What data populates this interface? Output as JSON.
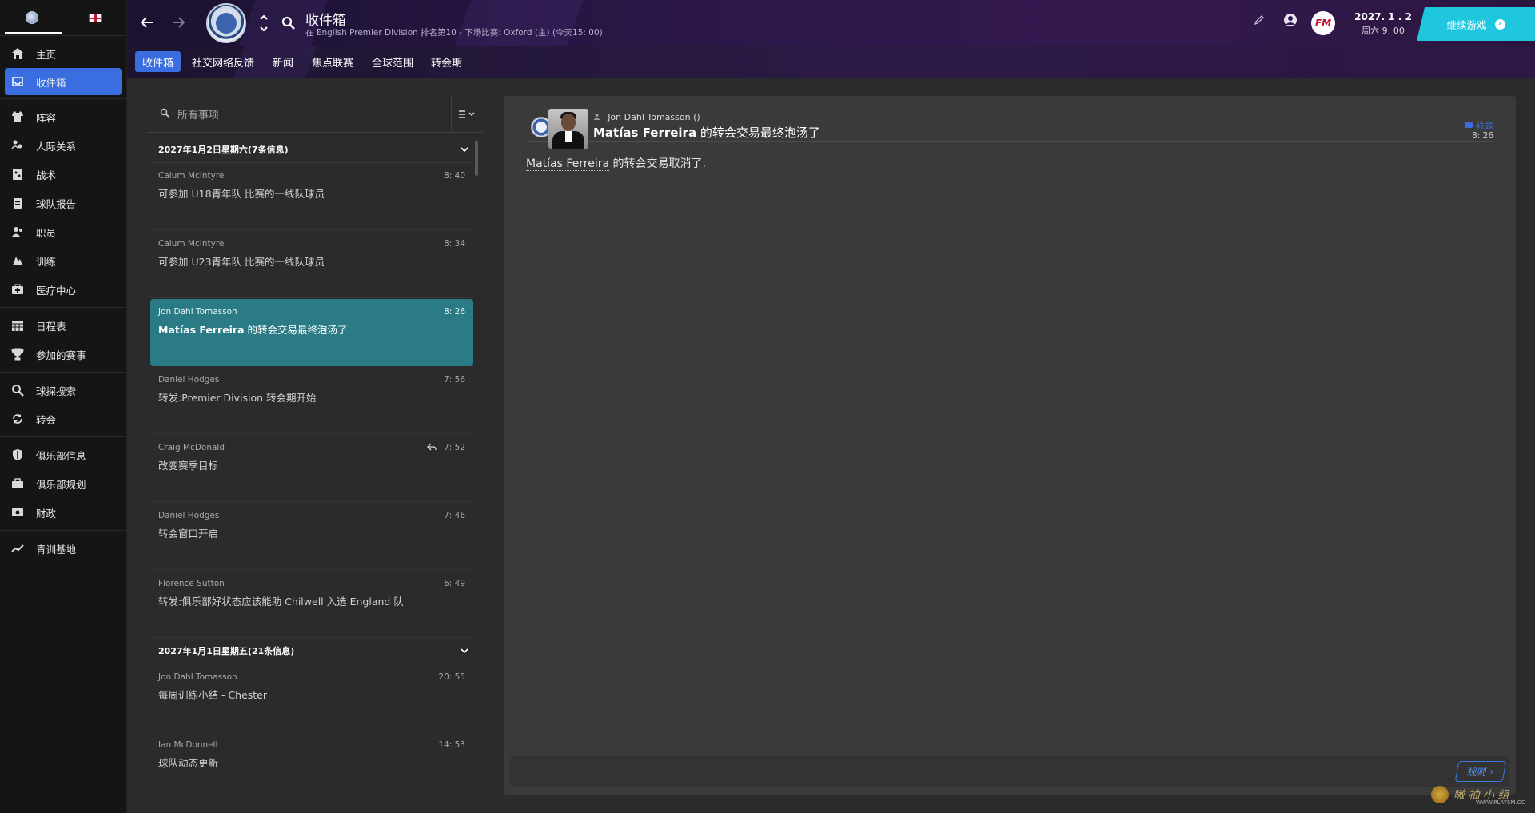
{
  "sidebar": {
    "items": [
      {
        "label": "主页",
        "icon": "home-icon"
      },
      {
        "label": "收件箱",
        "icon": "inbox-icon",
        "active": true
      },
      {
        "label": "阵容",
        "icon": "squad-shirt-icon"
      },
      {
        "label": "人际关系",
        "icon": "dynamics-icon"
      },
      {
        "label": "战术",
        "icon": "tactics-icon"
      },
      {
        "label": "球队报告",
        "icon": "report-clipboard-icon"
      },
      {
        "label": "职员",
        "icon": "staff-icon"
      },
      {
        "label": "训练",
        "icon": "training-icon"
      },
      {
        "label": "医疗中心",
        "icon": "medical-kit-icon"
      },
      {
        "label": "日程表",
        "icon": "calendar-icon"
      },
      {
        "label": "参加的赛事",
        "icon": "trophy-icon"
      },
      {
        "label": "球探搜索",
        "icon": "search-icon"
      },
      {
        "label": "转会",
        "icon": "transfer-icon"
      },
      {
        "label": "俱乐部信息",
        "icon": "shield-icon"
      },
      {
        "label": "俱乐部规划",
        "icon": "briefcase-icon"
      },
      {
        "label": "财政",
        "icon": "finance-icon"
      },
      {
        "label": "青训基地",
        "icon": "youth-chart-icon"
      }
    ]
  },
  "header": {
    "title": "收件箱",
    "subtitle": "在 English Premier Division 排名第10 - 下场比赛: Oxford (主) (今天15: 00)",
    "crest_text": "CHESTER",
    "date": "2027. 1 . 2",
    "weekday_time": "周六 9: 00",
    "continue_label": "继续游戏"
  },
  "tabs": [
    "收件箱",
    "社交网络反馈",
    "新闻",
    "焦点联赛",
    "全球范围",
    "转会期"
  ],
  "inbox": {
    "search_placeholder": "所有事项",
    "groups": [
      {
        "header": "2027年1月2日星期六(7条信息)",
        "messages": [
          {
            "from": "Calum McIntyre",
            "subject": "可参加 U18青年队 比赛的一线队球员",
            "time": "8: 40"
          },
          {
            "from": "Calum McIntyre",
            "subject": "可参加 U23青年队 比赛的一线队球员",
            "time": "8: 34"
          },
          {
            "from": "Jon Dahl Tomasson",
            "subject_bold": "Matías Ferreira",
            "subject": " 的转会交易最终泡汤了",
            "time": "8: 26",
            "selected": true
          },
          {
            "from": "Daniel Hodges",
            "subject": "转发:Premier Division 转会期开始",
            "time": "7: 56"
          },
          {
            "from": "Craig McDonald",
            "subject": "改变赛季目标",
            "time": "7: 52",
            "replied": true
          },
          {
            "from": "Daniel Hodges",
            "subject": "转会窗口开启",
            "time": "7: 46"
          },
          {
            "from": "Florence Sutton",
            "subject": "转发:俱乐部好状态应该能助 Chilwell 入选 England 队",
            "time": "6: 49"
          }
        ]
      },
      {
        "header": "2027年1月1日星期五(21条信息)",
        "messages": [
          {
            "from": "Jon Dahl Tomasson",
            "subject": "每周训练小结 - Chester",
            "time": "20: 55"
          },
          {
            "from": "Ian McDonnell",
            "subject": "球队动态更新",
            "time": "14: 53"
          }
        ]
      }
    ]
  },
  "detail": {
    "sender": "Jon Dahl Tomasson",
    "sender_suffix": "()",
    "title_bold": "Matías Ferreira",
    "title_rest": " 的转会交易最终泡汤了",
    "category": "转会",
    "time": "8: 26",
    "body_name": "Matías Ferreira",
    "body_rest": " 的转会交易取消了."
  },
  "rules_label": "规则",
  "watermark": {
    "text": "嗷 袖 小 组",
    "sub": "WWW.PLAYSM.CC"
  },
  "colors": {
    "accent": "#3a6ee0",
    "selected_row": "#2b7b86",
    "continue": "#1ec6de"
  }
}
